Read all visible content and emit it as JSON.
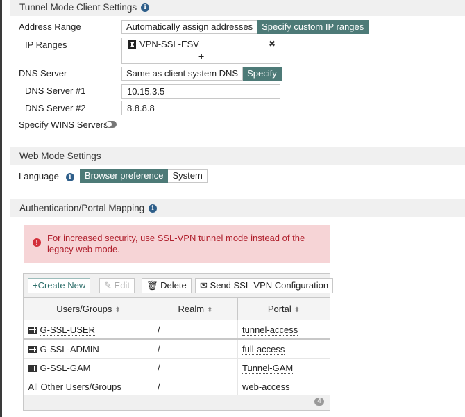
{
  "tunnel_mode": {
    "header": "Tunnel Mode Client Settings",
    "info_icon": "info-icon",
    "address_range": {
      "label": "Address Range",
      "options": [
        "Automatically assign addresses",
        "Specify custom IP ranges"
      ],
      "selected": "Specify custom IP ranges"
    },
    "ip_ranges": {
      "label": "IP Ranges",
      "entries": [
        "VPN-SSL-ESV"
      ],
      "remove_symbol": "✖",
      "add_symbol": "+"
    },
    "dns_server": {
      "label": "DNS Server",
      "options": [
        "Same as client system DNS",
        "Specify"
      ],
      "selected": "Specify"
    },
    "dns1": {
      "label": "DNS Server #1",
      "value": "10.15.3.5"
    },
    "dns2": {
      "label": "DNS Server #2",
      "value": "8.8.8.8"
    },
    "wins": {
      "label": "Specify WINS Servers",
      "enabled": false
    }
  },
  "web_mode": {
    "header": "Web Mode Settings",
    "language": {
      "label": "Language",
      "options": [
        "Browser preference",
        "System"
      ],
      "selected": "Browser preference"
    }
  },
  "auth_mapping": {
    "header": "Authentication/Portal Mapping",
    "alert": "For increased security, use SSL-VPN tunnel mode instead of the legacy web mode.",
    "toolbar": {
      "create": "Create New",
      "edit": "Edit",
      "delete": "Delete",
      "send": "Send SSL-VPN Configuration"
    },
    "columns": [
      "Users/Groups",
      "Realm",
      "Portal"
    ],
    "rows": [
      {
        "group": "G-SSL-USER",
        "realm": "/",
        "portal": "tunnel-access",
        "icon": "group-icon"
      },
      {
        "group": "G-SSL-ADMIN",
        "realm": "/",
        "portal": "full-access",
        "icon": "group-icon"
      },
      {
        "group": "G-SSL-GAM",
        "realm": "/",
        "portal": "Tunnel-GAM",
        "icon": "group-icon"
      },
      {
        "group": "All Other Users/Groups",
        "realm": "/",
        "portal": "web-access",
        "icon": ""
      }
    ],
    "count": "4"
  },
  "colors": {
    "accent": "#4d7a77",
    "alert_bg": "#f6d4d6",
    "alert_text": "#b0212e"
  }
}
